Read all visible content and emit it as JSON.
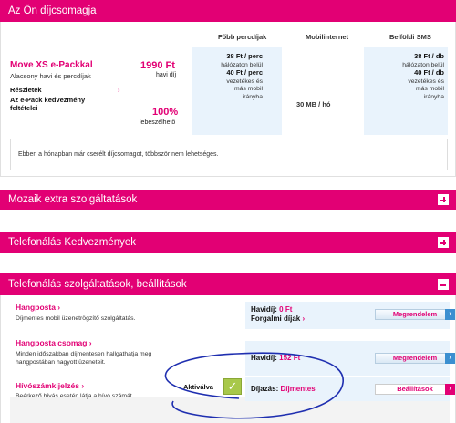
{
  "plan_section": {
    "title": "Az Ön díjcsomagja",
    "columns": [
      "Főbb percdíjak",
      "Mobilinternet",
      "Belföldi SMS"
    ],
    "plan_name": "Move XS e-Packkal",
    "plan_subtitle": "Alacsony havi és percdíjak",
    "details_link": "Részletek",
    "epack_link_line1": "Az e-Pack kedvezmény",
    "epack_link_line2": "feltételei",
    "price": "1990 Ft",
    "price_label": "havi díj",
    "discount": "100%",
    "discount_label": "lebeszélhető",
    "call_rates": {
      "rate1": "38 Ft / perc",
      "rate1_note": "hálózaton belül",
      "rate2": "40 Ft / perc",
      "rate2_note_1": "vezetékes és",
      "rate2_note_2": "más mobil",
      "rate2_note_3": "irányba"
    },
    "mobile_internet": "30 MB / hó",
    "sms_rates": {
      "rate1": "38 Ft / db",
      "rate1_note": "hálózaton belül",
      "rate2": "40 Ft / db",
      "rate2_note_1": "vezetékes és",
      "rate2_note_2": "más mobil",
      "rate2_note_3": "irányba"
    },
    "notice": "Ebben a hónapban már cserélt díjcsomagot, többször nem lehetséges."
  },
  "sections": {
    "mozaik": "Mozaik extra szolgáltatások",
    "kedvezmenyek": "Telefonálás Kedvezmények",
    "szolgaltatasok": "Telefonálás szolgáltatások, beállítások"
  },
  "services": [
    {
      "title": "Hangposta",
      "desc": "Díjmentes mobil üzenetrögzítő szolgáltatás.",
      "fee_label": "Havidíj:",
      "fee_value": "0 Ft",
      "extra_link": "Forgalmi díjak",
      "button": "Megrendelem"
    },
    {
      "title": "Hangposta csomag",
      "desc_1": "Minden időszakban díjmentesen hallgathatja meg",
      "desc_2": "hangpostában hagyott üzeneteit.",
      "fee_label": "Havidíj:",
      "fee_value": "152 Ft",
      "button": "Megrendelem"
    },
    {
      "title": "Hívószámkijelzés",
      "desc": "Beérkező hívás esetén látja a hívó számát.",
      "status": "Aktiválva",
      "fee_label": "Díjazás:",
      "fee_value": "Díjmentes",
      "button": "Beállítások"
    }
  ],
  "colors": {
    "brand": "#e20074",
    "light_blue": "#e9f3fc",
    "annotation": "#1f2fb0"
  }
}
